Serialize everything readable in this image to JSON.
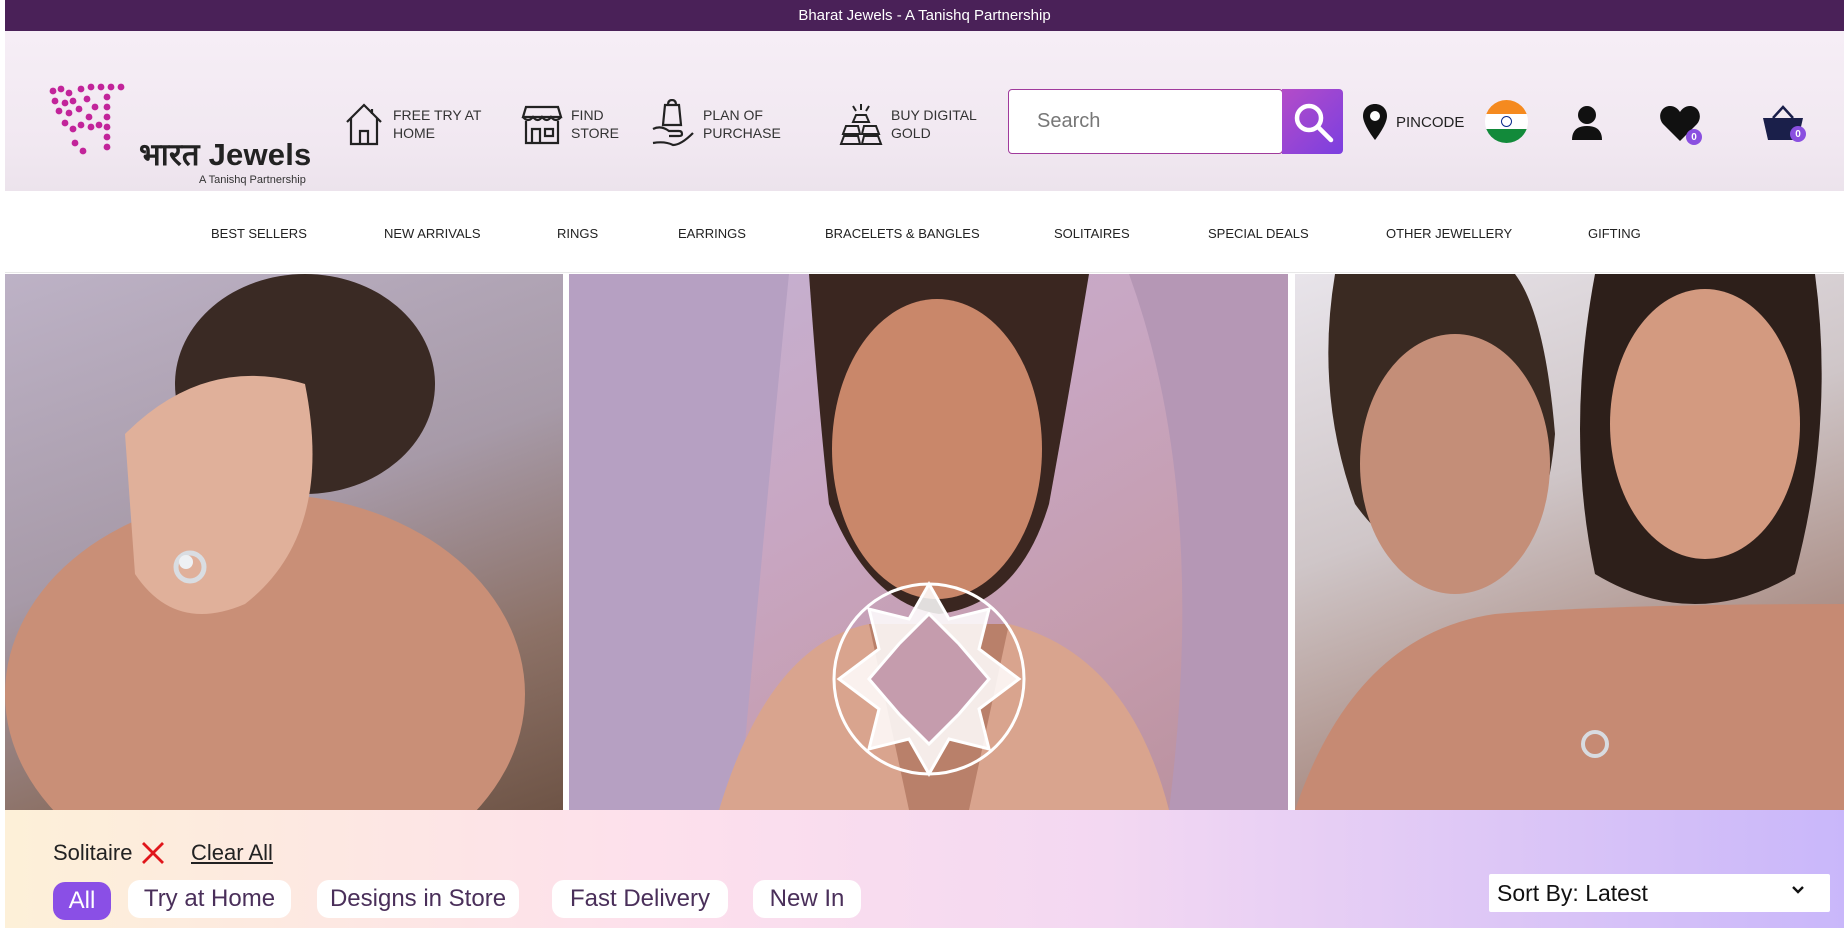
{
  "promo": {
    "text": "Bharat Jewels - A Tanishq Partnership"
  },
  "brand": {
    "name": "भारत Jewels",
    "tagline": "A Tanishq Partnership",
    "logo_glyph": "भ"
  },
  "header_links": [
    {
      "label": "FREE TRY AT HOME",
      "icon": "home-icon"
    },
    {
      "label": "FIND STORE",
      "icon": "store-icon"
    },
    {
      "label": "PLAN OF PURCHASE",
      "icon": "shopping-bag-hand-icon"
    },
    {
      "label": "BUY DIGITAL GOLD",
      "icon": "gold-bars-icon"
    }
  ],
  "search": {
    "placeholder": "Search"
  },
  "pincode": {
    "label": "PINCODE"
  },
  "wishlist": {
    "count": "0"
  },
  "cart": {
    "count": "0"
  },
  "nav": [
    "BEST SELLERS",
    "NEW ARRIVALS",
    "RINGS",
    "EARRINGS",
    "BRACELETS & BANGLES",
    "SOLITAIRES",
    "SPECIAL DEALS",
    "OTHER JEWELLERY",
    "GIFTING"
  ],
  "filters": {
    "active_chip": "Solitaire",
    "clear_label": "Clear All",
    "pills": [
      "All",
      "Try at Home",
      "Designs in Store",
      "Fast Delivery",
      "New In"
    ],
    "selected_pill": "All",
    "sort_label": "Sort By: Latest"
  },
  "colors": {
    "promo_bg": "#4a2158",
    "accent_purple": "#8a4fe6",
    "search_border": "#a03a9c",
    "clear_x": "#e0161b"
  }
}
